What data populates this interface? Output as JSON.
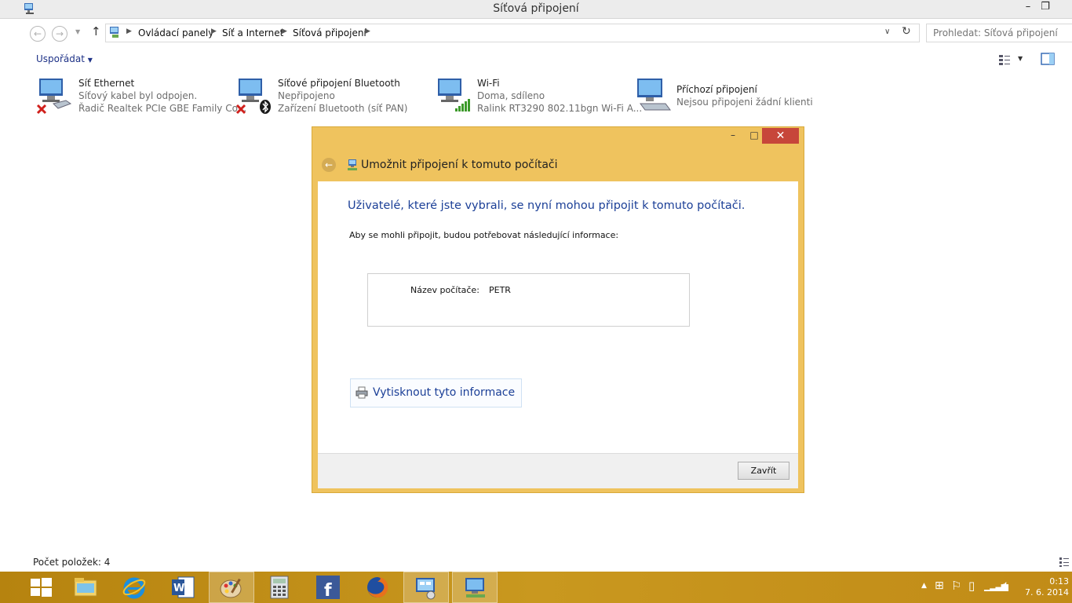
{
  "window": {
    "title": "Síťová připojení"
  },
  "address": {
    "crumbs": [
      "Ovládací panely",
      "Síť a Internet",
      "Síťová připojení"
    ],
    "search_placeholder": "Prohledat: Síťová připojení"
  },
  "commandbar": {
    "organize": "Uspořádat"
  },
  "connections": [
    {
      "name": "Síť Ethernet",
      "status": "Síťový kabel byl odpojen.",
      "device": "Řadič Realtek PCIe GBE Family Co..."
    },
    {
      "name": "Síťové připojení Bluetooth",
      "status": "Nepřipojeno",
      "device": "Zařízení Bluetooth (síť PAN)"
    },
    {
      "name": "Wi-Fi",
      "status": "Doma, sdíleno",
      "device": "Ralink RT3290 802.11bgn Wi-Fi A..."
    },
    {
      "name": "Příchozí připojení",
      "status": "Nejsou připojeni žádní klienti"
    }
  ],
  "dialog": {
    "title": "Umožnit připojení k tomuto počítači",
    "heading": "Uživatelé, které jste vybrali, se nyní mohou připojit k tomuto počítači.",
    "description": "Aby se mohli připojit, budou potřebovat následující informace:",
    "info": {
      "label": "Název počítače:",
      "value": "PETR"
    },
    "print_label": "Vytisknout tyto informace",
    "close_label": "Zavřít"
  },
  "statusbar": {
    "count": "Počet položek: 4"
  },
  "clock": {
    "time": "0:13",
    "date": "7. 6. 2014"
  },
  "colors": {
    "taskbar": "#c18b17",
    "dialog_frame": "#efc35e",
    "close_red": "#c7463a",
    "link_blue": "#1b3f97"
  }
}
